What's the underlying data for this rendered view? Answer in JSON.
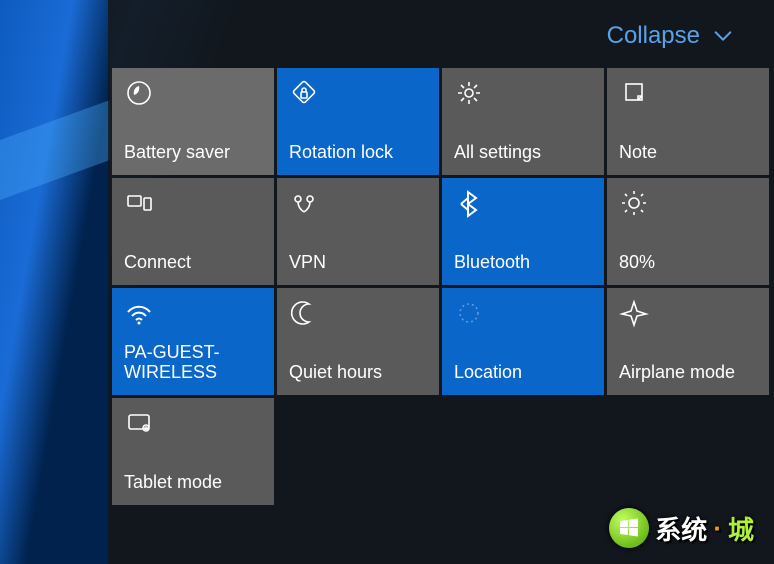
{
  "header": {
    "collapse_label": "Collapse"
  },
  "tiles": [
    {
      "id": "battery-saver",
      "label": "Battery saver",
      "icon": "leaf-icon",
      "active": false
    },
    {
      "id": "rotation-lock",
      "label": "Rotation lock",
      "icon": "rotation-lock-icon",
      "active": true
    },
    {
      "id": "all-settings",
      "label": "All settings",
      "icon": "gear-icon",
      "active": false
    },
    {
      "id": "note",
      "label": "Note",
      "icon": "note-icon",
      "active": false
    },
    {
      "id": "connect",
      "label": "Connect",
      "icon": "connect-icon",
      "active": false
    },
    {
      "id": "vpn",
      "label": "VPN",
      "icon": "vpn-icon",
      "active": false
    },
    {
      "id": "bluetooth",
      "label": "Bluetooth",
      "icon": "bluetooth-icon",
      "active": true
    },
    {
      "id": "brightness",
      "label": "80%",
      "icon": "brightness-icon",
      "active": false
    },
    {
      "id": "wifi",
      "label": "PA-GUEST-WIRELESS",
      "icon": "wifi-icon",
      "active": true
    },
    {
      "id": "quiet-hours",
      "label": "Quiet hours",
      "icon": "moon-icon",
      "active": false
    },
    {
      "id": "location",
      "label": "Location",
      "icon": "location-icon",
      "active": true
    },
    {
      "id": "airplane-mode",
      "label": "Airplane mode",
      "icon": "airplane-icon",
      "active": false
    },
    {
      "id": "tablet-mode",
      "label": "Tablet mode",
      "icon": "tablet-icon",
      "active": false
    }
  ],
  "watermark": {
    "text1": "系统",
    "dot": "·",
    "text2": "城"
  }
}
